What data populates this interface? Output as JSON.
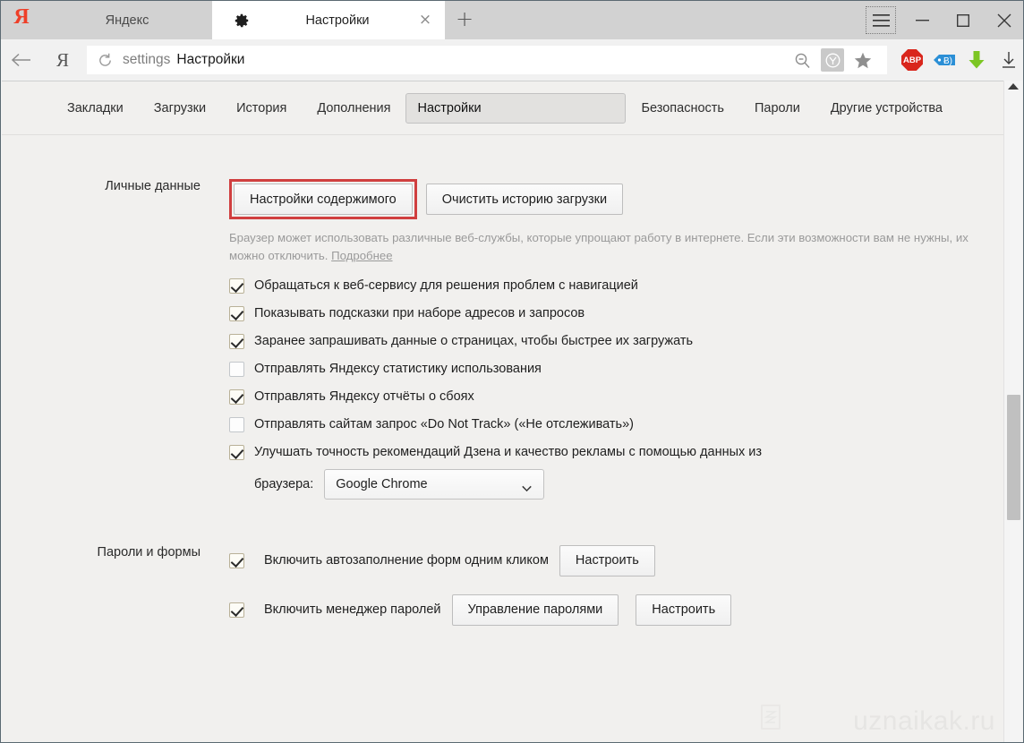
{
  "window": {
    "controls": {
      "menu": "menu-hamburger",
      "minimize": "minimize",
      "maximize": "maximize",
      "close": "close"
    }
  },
  "tabs": [
    {
      "label": "Яндекс",
      "active": false,
      "icon": "yandex-logo"
    },
    {
      "label": "Настройки",
      "active": true,
      "icon": "gear-icon",
      "close": "×"
    }
  ],
  "newtab_label": "+",
  "omnibox": {
    "scheme": "settings",
    "title": "Настройки",
    "reload_icon": "reload-icon",
    "icons": [
      "zoom-out-icon",
      "yandex-shield-icon",
      "bookmark-star-icon"
    ]
  },
  "extensions": [
    {
      "name": "adblock-plus",
      "label": "ABP",
      "color": "#d9261c"
    },
    {
      "name": "savefrom-extension",
      "label": "",
      "color": "#2b8fd6"
    },
    {
      "name": "download-helper-extension",
      "label": "",
      "color": "#7cc623"
    },
    {
      "name": "downloads-button",
      "label": "",
      "color": "#3a3a3a"
    }
  ],
  "subnav": {
    "items": [
      {
        "label": "Закладки",
        "selected": false
      },
      {
        "label": "Загрузки",
        "selected": false
      },
      {
        "label": "История",
        "selected": false
      },
      {
        "label": "Дополнения",
        "selected": false
      },
      {
        "label": "Настройки",
        "selected": true
      },
      {
        "label": "Безопасность",
        "selected": false
      },
      {
        "label": "Пароли",
        "selected": false
      },
      {
        "label": "Другие устройства",
        "selected": false
      }
    ]
  },
  "personal_data": {
    "section_label": "Личные данные",
    "content_settings_button": "Настройки содержимого",
    "clear_history_button": "Очистить историю загрузки",
    "description_line1": "Браузер может использовать различные веб-службы, которые упрощают работу в интернете. Если эти возможности вам",
    "description_line2": "не нужны, их можно отключить.",
    "more_link": "Подробнее",
    "checkboxes": [
      {
        "label": "Обращаться к веб-сервису для решения проблем с навигацией",
        "checked": true
      },
      {
        "label": "Показывать подсказки при наборе адресов и запросов",
        "checked": true
      },
      {
        "label": "Заранее запрашивать данные о страницах, чтобы быстрее их загружать",
        "checked": true
      },
      {
        "label": "Отправлять Яндексу статистику использования",
        "checked": false
      },
      {
        "label": "Отправлять Яндексу отчёты о сбоях",
        "checked": true
      },
      {
        "label": "Отправлять сайтам запрос «Do Not Track» («Не отслеживать»)",
        "checked": false
      },
      {
        "label": "Улучшать точность рекомендаций Дзена и качество рекламы с помощью данных из",
        "checked": true
      }
    ],
    "browser_select_label": "браузера:",
    "browser_select_value": "Google Chrome"
  },
  "passwords_forms": {
    "section_label": "Пароли и формы",
    "autofill": {
      "label": "Включить автозаполнение форм одним кликом",
      "checked": true,
      "button": "Настроить"
    },
    "manager": {
      "label": "Включить менеджер паролей",
      "checked": true,
      "manage_button": "Управление паролями",
      "settings_button": "Настроить"
    }
  },
  "watermark": "uznaikak.ru",
  "colors": {
    "highlight_red": "#d03f3f",
    "tab_active_bg": "#ffffff",
    "tabstrip_bg": "#d2d2d2",
    "content_bg": "#f1f0ee",
    "subnav_selected_bg": "#e2e1df"
  }
}
